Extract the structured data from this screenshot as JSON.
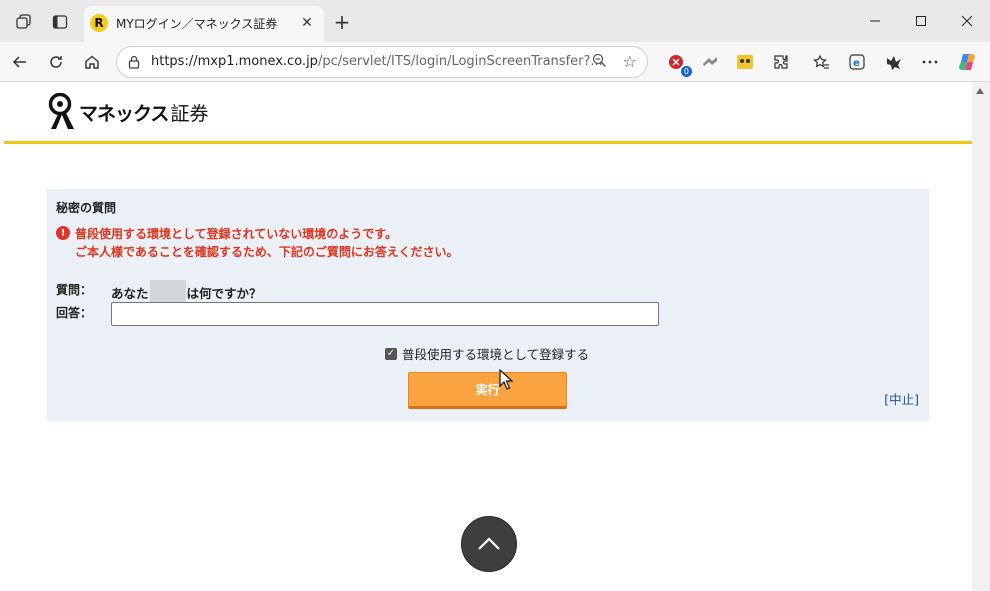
{
  "browser": {
    "tab_title": "MYログイン／マネックス証券",
    "tab_favicon_letter": "R",
    "url_main": "https://mxp1.monex.co.jp",
    "url_rest": "/pc/servlet/ITS/login/LoginScreenTransfer?...",
    "extension_badge": "0",
    "icons": [
      "workspaces-icon",
      "tab-actions-icon",
      "back-icon",
      "refresh-icon",
      "home-icon",
      "lock-icon",
      "zoom-icon",
      "favorite-star-icon",
      "extension-icon",
      "collections-icon",
      "settings-more-icon",
      "copilot-icon"
    ]
  },
  "site": {
    "brand": "マネックス",
    "brand_suffix": "証券",
    "accent_color": "#f2c311"
  },
  "panel": {
    "title": "秘密の質問",
    "warning_line1": "普段使用する環境として登録されていない環境のようです。",
    "warning_line2": "ご本人様であることを確認するため、下記のご質問にお答えください。",
    "question_label": "質問：",
    "question_prefix": "あなた",
    "question_suffix": "は何ですか？",
    "answer_label": "回答：",
    "answer_value": "",
    "checkbox_label": "普段使用する環境として登録する",
    "checkbox_checked": true,
    "submit_label": "実行",
    "cancel_label": "[中止]",
    "warning_color": "#e0341f",
    "button_color": "#fba341"
  }
}
